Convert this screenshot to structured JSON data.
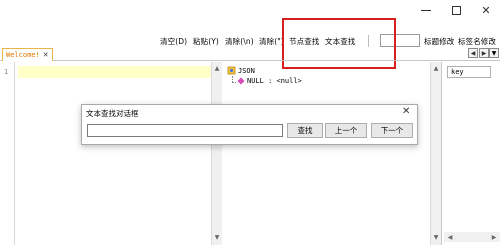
{
  "window": {
    "minimize_icon": "minimize-icon",
    "maximize_icon": "maximize-icon",
    "close_glyph": "✕"
  },
  "toolbar": {
    "items": [
      {
        "label": "清空(D)"
      },
      {
        "label": "粘贴(Y)"
      },
      {
        "label": "清除(\\n)"
      },
      {
        "label": "清除(\")"
      },
      {
        "label": "节点查找"
      },
      {
        "label": "文本查找"
      }
    ],
    "input_value": "",
    "title_edit_label": "标题修改",
    "sign_edit_label": "标签名修改",
    "highlight_color": "#d61f1f"
  },
  "tab": {
    "label": "Welcome!",
    "close_glyph": "✕"
  },
  "tab_nav": {
    "prev": "◀",
    "next": "▶",
    "dropdown": "▼"
  },
  "editor": {
    "line_number": "1",
    "line_highlight_color": "#ffffc8"
  },
  "tree": {
    "root_label": "JSON",
    "child_label": "NULL : <null>",
    "expander_glyph": "−"
  },
  "right_panel": {
    "header": "key"
  },
  "dialog": {
    "title": "文本查找对话框",
    "close_glyph": "✕",
    "input_value": "",
    "find_label": "查找",
    "prev_label": "上一个",
    "next_label": "下一个"
  },
  "scroll": {
    "up": "▲",
    "down": "▼",
    "left": "◀",
    "right": "▶"
  }
}
